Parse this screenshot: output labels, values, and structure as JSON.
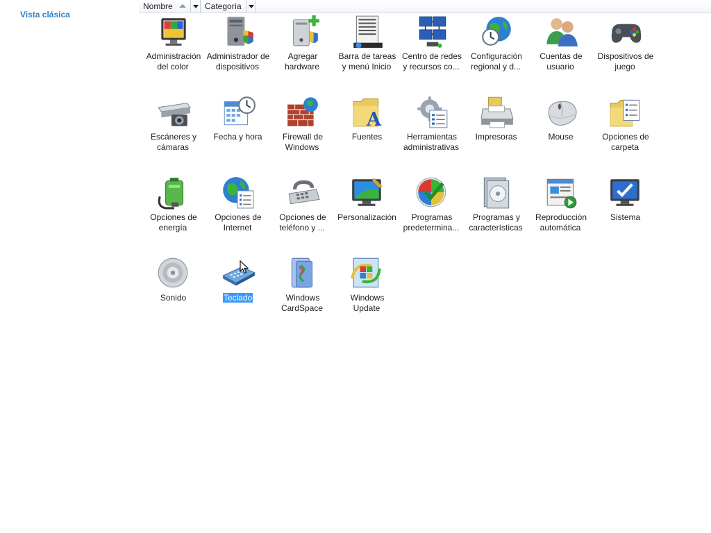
{
  "sidebar": {
    "link_label": "Vista clásica"
  },
  "columns": [
    {
      "label": "Nombre"
    },
    {
      "label": "Categoría"
    }
  ],
  "items": [
    {
      "label": "Administración del color",
      "icon": "color-management-icon"
    },
    {
      "label": "Administrador de dispositivos",
      "icon": "device-manager-icon"
    },
    {
      "label": "Agregar hardware",
      "icon": "add-hardware-icon"
    },
    {
      "label": "Barra de tareas y menú Inicio",
      "icon": "taskbar-start-menu-icon"
    },
    {
      "label": "Centro de redes y recursos co...",
      "icon": "network-center-icon"
    },
    {
      "label": "Configuración regional y d...",
      "icon": "regional-settings-icon"
    },
    {
      "label": "Cuentas de usuario",
      "icon": "user-accounts-icon"
    },
    {
      "label": "Dispositivos de juego",
      "icon": "game-controllers-icon"
    },
    {
      "label": "Escáneres y cámaras",
      "icon": "scanners-cameras-icon"
    },
    {
      "label": "Fecha y hora",
      "icon": "date-time-icon"
    },
    {
      "label": "Firewall de Windows",
      "icon": "firewall-icon"
    },
    {
      "label": "Fuentes",
      "icon": "fonts-icon"
    },
    {
      "label": "Herramientas administrativas",
      "icon": "admin-tools-icon"
    },
    {
      "label": "Impresoras",
      "icon": "printers-icon"
    },
    {
      "label": "Mouse",
      "icon": "mouse-icon"
    },
    {
      "label": "Opciones de carpeta",
      "icon": "folder-options-icon"
    },
    {
      "label": "Opciones de energía",
      "icon": "power-options-icon"
    },
    {
      "label": "Opciones de Internet",
      "icon": "internet-options-icon"
    },
    {
      "label": "Opciones de teléfono y ...",
      "icon": "phone-modem-icon"
    },
    {
      "label": "Personalización",
      "icon": "personalization-icon"
    },
    {
      "label": "Programas predetermina...",
      "icon": "default-programs-icon"
    },
    {
      "label": "Programas y características",
      "icon": "programs-features-icon"
    },
    {
      "label": "Reproducción automática",
      "icon": "autoplay-icon"
    },
    {
      "label": "Sistema",
      "icon": "system-icon"
    },
    {
      "label": "Sonido",
      "icon": "sound-icon"
    },
    {
      "label": "Teclado",
      "icon": "keyboard-icon",
      "selected": true
    },
    {
      "label": "Windows CardSpace",
      "icon": "cardspace-icon"
    },
    {
      "label": "Windows Update",
      "icon": "windows-update-icon"
    }
  ],
  "colors": {
    "link": "#2f80c4",
    "selection": "#3399ff"
  }
}
